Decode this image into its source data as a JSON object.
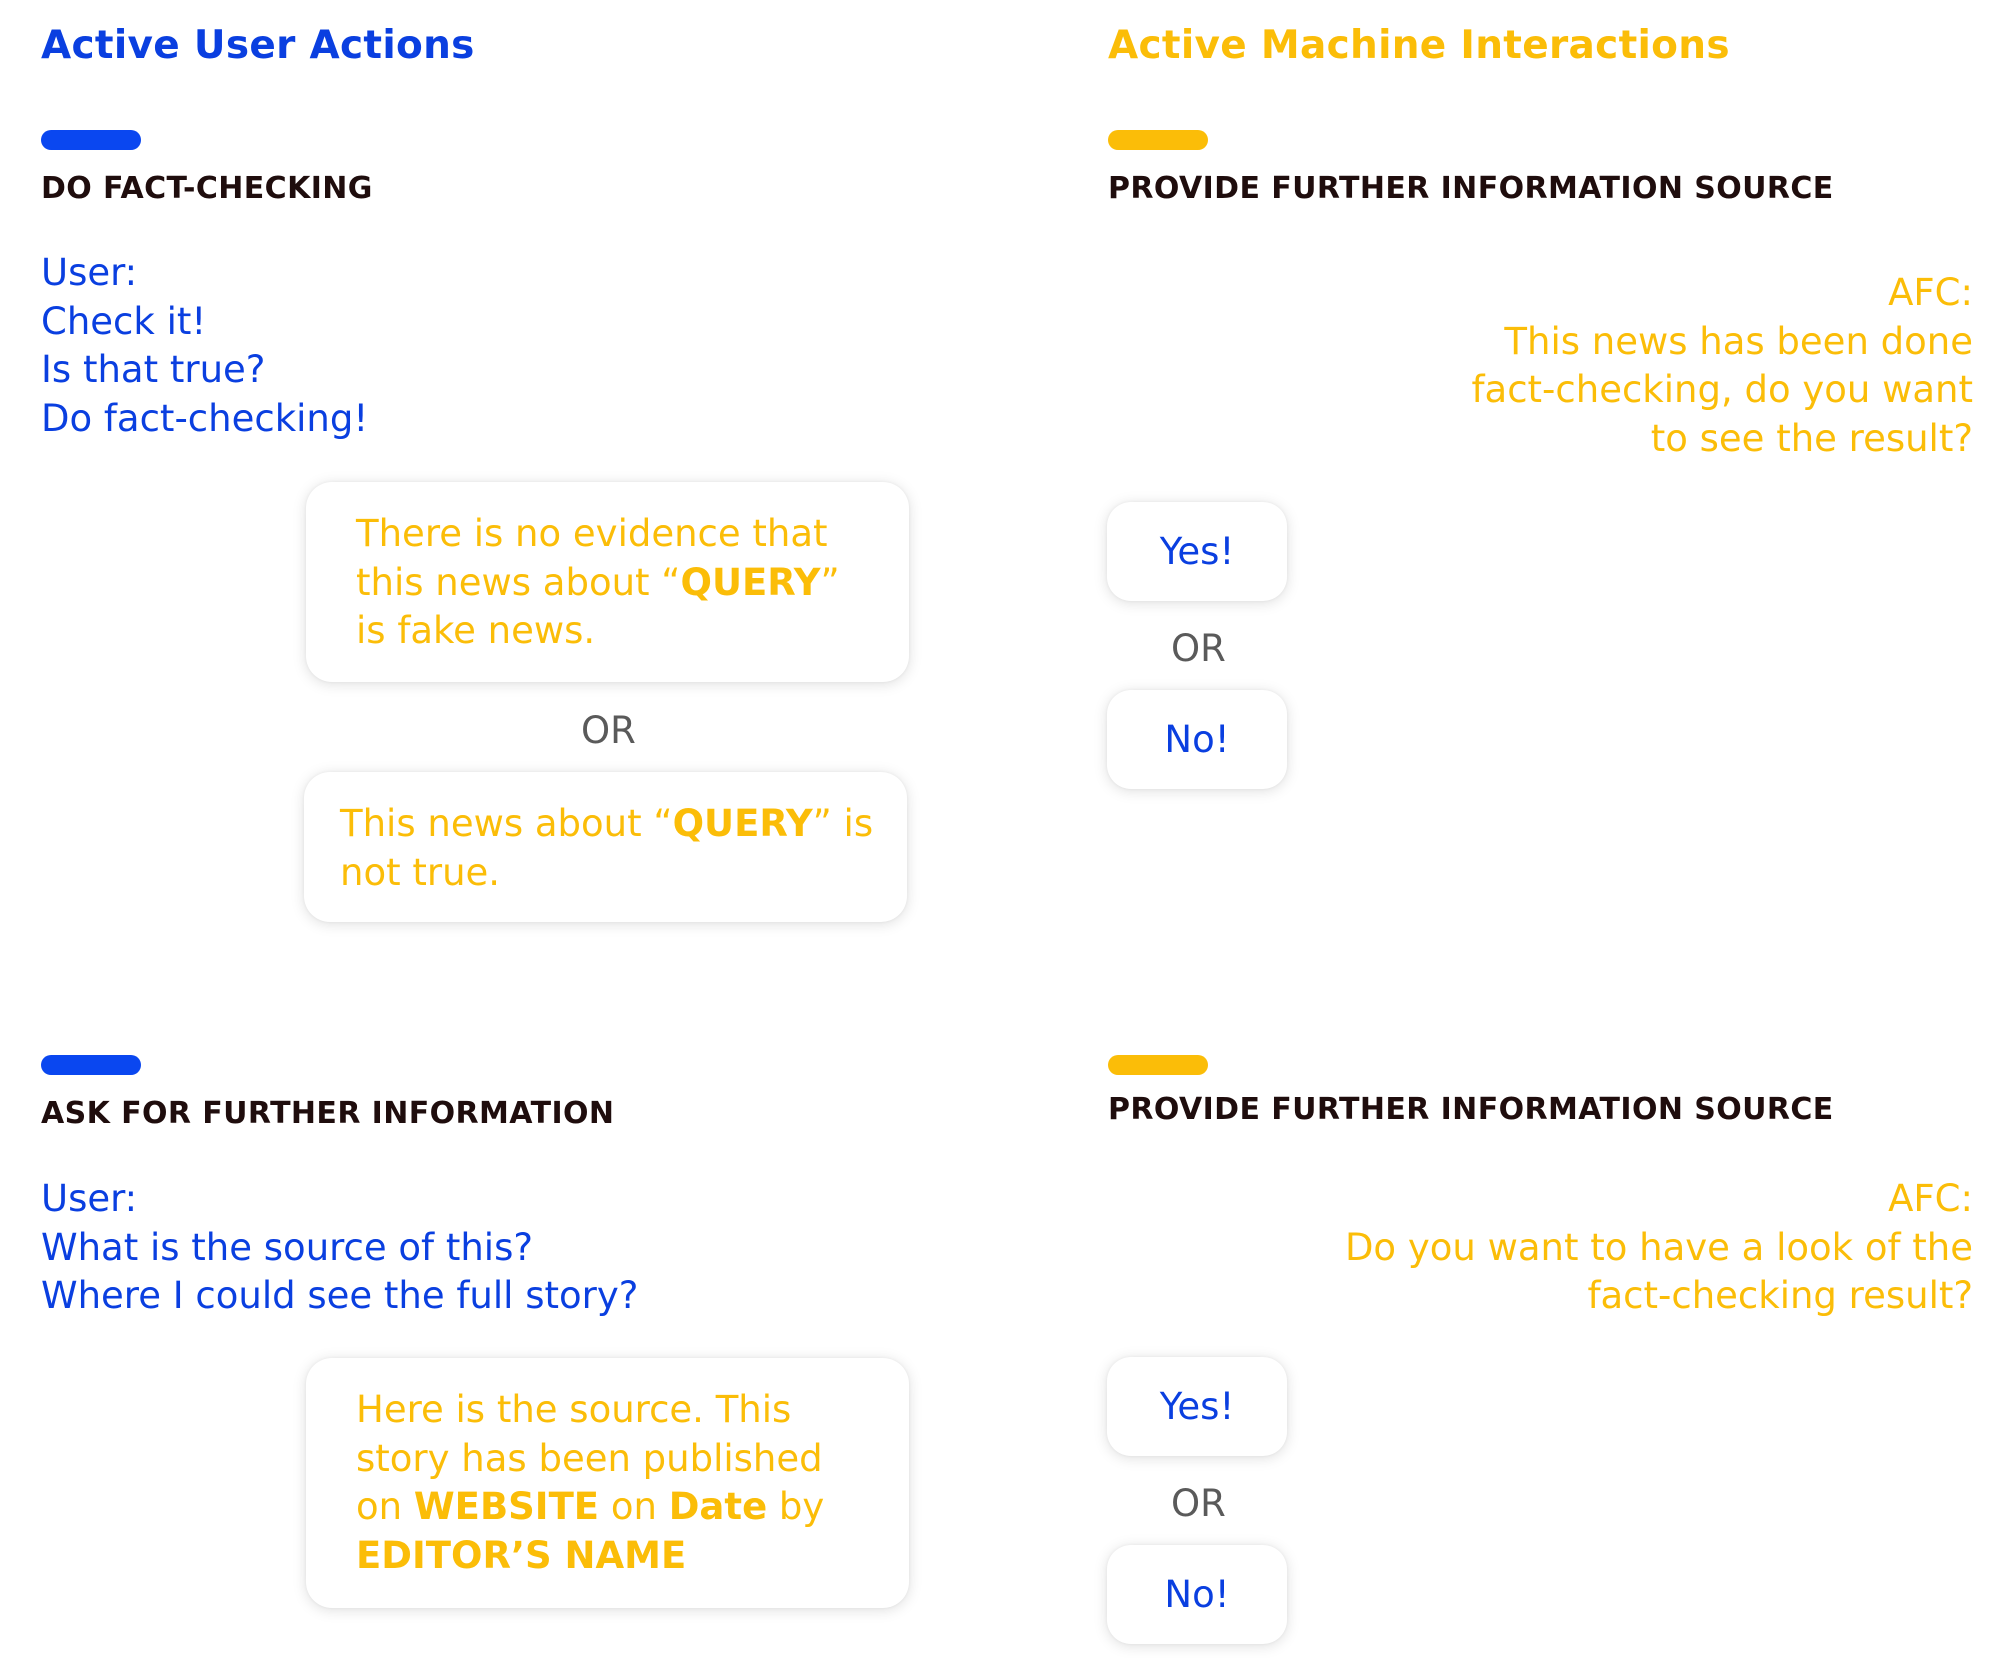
{
  "left_column": {
    "title": "Active User Actions",
    "sections": [
      {
        "heading": "DO FACT-CHECKING",
        "dialog_lines": [
          "User:",
          "Check it!",
          "Is that true?",
          "Do fact-checking!"
        ],
        "responses": [
          {
            "lines": [
              [
                {
                  "text": "There is no evidence that",
                  "bold": false
                }
              ],
              [
                {
                  "text": "this news about “",
                  "bold": false
                },
                {
                  "text": "QUERY",
                  "bold": true
                },
                {
                  "text": "”",
                  "bold": false
                }
              ],
              [
                {
                  "text": "is fake news.",
                  "bold": false
                }
              ]
            ]
          },
          {
            "lines": [
              [
                {
                  "text": "This news about “",
                  "bold": false
                },
                {
                  "text": "QUERY",
                  "bold": true
                },
                {
                  "text": "” is",
                  "bold": false
                }
              ],
              [
                {
                  "text": "not true.",
                  "bold": false
                }
              ]
            ]
          }
        ],
        "or_label": "OR"
      },
      {
        "heading": "ASK FOR FURTHER INFORMATION",
        "dialog_lines": [
          "User:",
          "What is the source of this?",
          "Where I could see the full story?"
        ],
        "responses": [
          {
            "lines": [
              [
                {
                  "text": "Here is the source. This",
                  "bold": false
                }
              ],
              [
                {
                  "text": "story has been published",
                  "bold": false
                }
              ],
              [
                {
                  "text": "on ",
                  "bold": false
                },
                {
                  "text": "WEBSITE",
                  "bold": true
                },
                {
                  "text": " on ",
                  "bold": false
                },
                {
                  "text": "Date",
                  "bold": true
                },
                {
                  "text": " by",
                  "bold": false
                }
              ],
              [
                {
                  "text": "EDITOR’S NAME",
                  "bold": true
                }
              ]
            ]
          }
        ]
      }
    ]
  },
  "right_column": {
    "title": "Active Machine Interactions",
    "sections": [
      {
        "heading": "PROVIDE FURTHER INFORMATION SOURCE",
        "dialog_lines": [
          "AFC:",
          "This news has been done",
          "fact-checking, do you want",
          "to see the result?"
        ],
        "yes_label": "Yes!",
        "or_label": "OR",
        "no_label": "No!"
      },
      {
        "heading": "PROVIDE FURTHER INFORMATION SOURCE",
        "dialog_lines": [
          "AFC:",
          "Do you want to have a look of the",
          "fact-checking result?"
        ],
        "yes_label": "Yes!",
        "or_label": "OR",
        "no_label": "No!"
      }
    ]
  },
  "colors": {
    "user_blue": "#0a3fe0",
    "machine_yellow": "#fbbd08",
    "heading_dark": "#1f0d0d",
    "or_gray": "#5a5a5a"
  }
}
